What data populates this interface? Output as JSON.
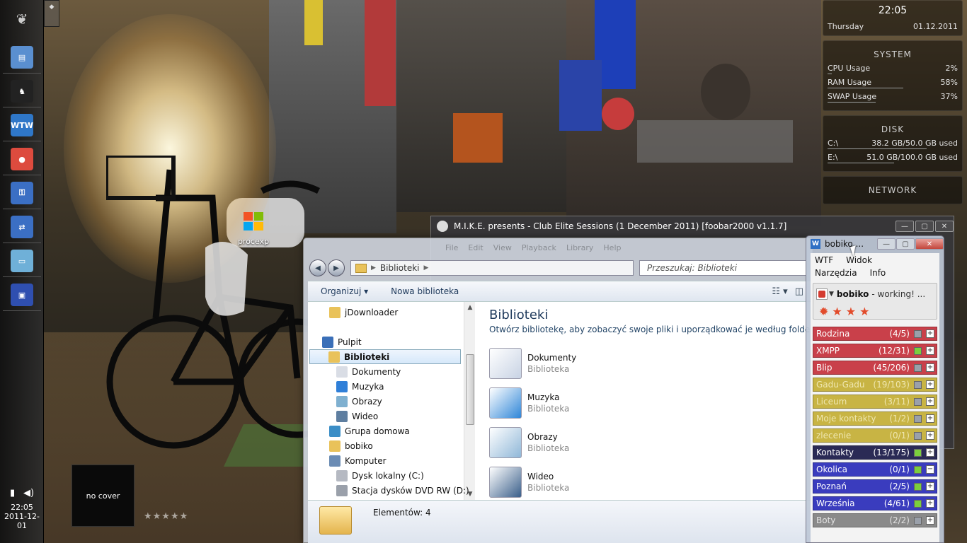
{
  "colors": {
    "accent": "#1e395b",
    "star": "#e24b2b"
  },
  "taskbar": {
    "icons": [
      {
        "name": "start-orb-icon",
        "glyph": "❦"
      },
      {
        "name": "file-manager-icon",
        "glyph": "▤"
      },
      {
        "name": "foobar-icon",
        "glyph": "♞"
      },
      {
        "name": "wtw-icon",
        "glyph": "WTW"
      },
      {
        "name": "chrome-icon",
        "glyph": "●"
      },
      {
        "name": "keyfile-icon",
        "glyph": "⚿"
      },
      {
        "name": "network-icon",
        "glyph": "⇄"
      },
      {
        "name": "notepad-icon",
        "glyph": "▭"
      },
      {
        "name": "floppy-icon",
        "glyph": "▣"
      }
    ],
    "clock_time": "22:05",
    "clock_date": "2011-12-01"
  },
  "desktop": {
    "icon_label": "procexp",
    "no_cover": "no cover",
    "cover_stars": "★★★★★"
  },
  "conky": {
    "time": "22:05",
    "day": "Thursday",
    "date": "01.12.2011",
    "system": {
      "title": "SYSTEM",
      "rows": [
        {
          "label": "CPU Usage",
          "value": "2%",
          "pct": 2
        },
        {
          "label": "RAM Usage",
          "value": "58%",
          "pct": 58
        },
        {
          "label": "SWAP Usage",
          "value": "37%",
          "pct": 37
        }
      ]
    },
    "disk": {
      "title": "DISK",
      "rows": [
        {
          "label": "C:\\",
          "value": "38.2 GB/50.0 GB used",
          "pct": 76
        },
        {
          "label": "E:\\",
          "value": "51.0 GB/100.0 GB used",
          "pct": 51
        }
      ]
    },
    "network": {
      "title": "NETWORK"
    }
  },
  "foobar": {
    "title": "M.I.K.E. presents - Club Elite Sessions (1 December 2011)   [foobar2000 v1.1.7]"
  },
  "explorer": {
    "ghost_menu": [
      "File",
      "Edit",
      "View",
      "Playback",
      "Library",
      "Help"
    ],
    "crumb": "Biblioteki",
    "search_placeholder": "Przeszukaj: Biblioteki",
    "cmd_organize": "Organizuj ▾",
    "cmd_new": "Nowa biblioteka",
    "nav": [
      {
        "label": "jDownloader",
        "indent": 1,
        "color": "#e9c25a"
      },
      {
        "label": "Pulpit",
        "indent": 0,
        "color": "#3a6fb8"
      },
      {
        "label": "Biblioteki",
        "indent": 1,
        "color": "#e9c25a",
        "selected": true
      },
      {
        "label": "Dokumenty",
        "indent": 2,
        "color": "#d9dde5"
      },
      {
        "label": "Muzyka",
        "indent": 2,
        "color": "#2f7fd8"
      },
      {
        "label": "Obrazy",
        "indent": 2,
        "color": "#7fb0d0"
      },
      {
        "label": "Wideo",
        "indent": 2,
        "color": "#5e7ea0"
      },
      {
        "label": "Grupa domowa",
        "indent": 1,
        "color": "#3b8ec7"
      },
      {
        "label": "bobiko",
        "indent": 1,
        "color": "#e9c25a"
      },
      {
        "label": "Komputer",
        "indent": 1,
        "color": "#6b8cb4"
      },
      {
        "label": "Dysk lokalny (C:)",
        "indent": 2,
        "color": "#b5b9c2"
      },
      {
        "label": "Stacja dysków DVD RW (D:)",
        "indent": 2,
        "color": "#9aa0aa"
      }
    ],
    "main_title": "Biblioteki",
    "main_sub": "Otwórz bibliotekę, aby zobaczyć swoje pliki i uporządkować je według folderu, da...",
    "libs": [
      {
        "name": "Dokumenty",
        "type": "Biblioteka",
        "color": "#c8d3e4"
      },
      {
        "name": "Muzyka",
        "type": "Biblioteka",
        "color": "#2f86d8"
      },
      {
        "name": "Obrazy",
        "type": "Biblioteka",
        "color": "#8fb7d8"
      },
      {
        "name": "Wideo",
        "type": "Biblioteka",
        "color": "#3a5f8a"
      }
    ],
    "status": "Elementów: 4"
  },
  "im": {
    "title": "bobiko ...",
    "menu": [
      "WTF",
      "Widok",
      "Narzędzia",
      "Info"
    ],
    "nick": "bobiko",
    "status_text": "- working! ...",
    "stars": "✹★★★",
    "groups": [
      {
        "name": "Rodzina",
        "count": "(4/5)",
        "bg": "#c9404a",
        "fg": "#fff",
        "dot": "#9aa0aa",
        "sign": "+"
      },
      {
        "name": "XMPP",
        "count": "(12/31)",
        "bg": "#c9404a",
        "fg": "#fff",
        "dot": "#7bcf3e",
        "sign": "+"
      },
      {
        "name": "Blip",
        "count": "(45/206)",
        "bg": "#c9404a",
        "fg": "#fff",
        "dot": "#9aa0aa",
        "sign": "+"
      },
      {
        "name": "Gadu-Gadu",
        "count": "(19/103)",
        "bg": "#c8b444",
        "fg": "#efe7b0",
        "dot": "#9aa0aa",
        "sign": "+"
      },
      {
        "name": "Liceum",
        "count": "(3/11)",
        "bg": "#c8b444",
        "fg": "#efe7b0",
        "dot": "#9aa0aa",
        "sign": "+"
      },
      {
        "name": "Moje kontakty",
        "count": "(1/2)",
        "bg": "#c8b444",
        "fg": "#efe7b0",
        "dot": "#9aa0aa",
        "sign": "+"
      },
      {
        "name": "zlecenie",
        "count": "(0/1)",
        "bg": "#c8b444",
        "fg": "#efe7b0",
        "dot": "#9aa0aa",
        "sign": "+"
      },
      {
        "name": "Kontakty",
        "count": "(13/175)",
        "bg": "#2a2a55",
        "fg": "#fff",
        "dot": "#7bcf3e",
        "sign": "+"
      },
      {
        "name": "Okolica",
        "count": "(0/1)",
        "bg": "#3a3cbe",
        "fg": "#fff",
        "dot": "#7bcf3e",
        "sign": "−"
      },
      {
        "name": "Poznań",
        "count": "(2/5)",
        "bg": "#3a3cbe",
        "fg": "#fff",
        "dot": "#7bcf3e",
        "sign": "+"
      },
      {
        "name": "Września",
        "count": "(4/61)",
        "bg": "#3a3cbe",
        "fg": "#fff",
        "dot": "#7bcf3e",
        "sign": "+"
      },
      {
        "name": "Boty",
        "count": "(2/2)",
        "bg": "#8a8a8a",
        "fg": "#e2e2e2",
        "dot": "#9aa0aa",
        "sign": "+"
      }
    ]
  }
}
